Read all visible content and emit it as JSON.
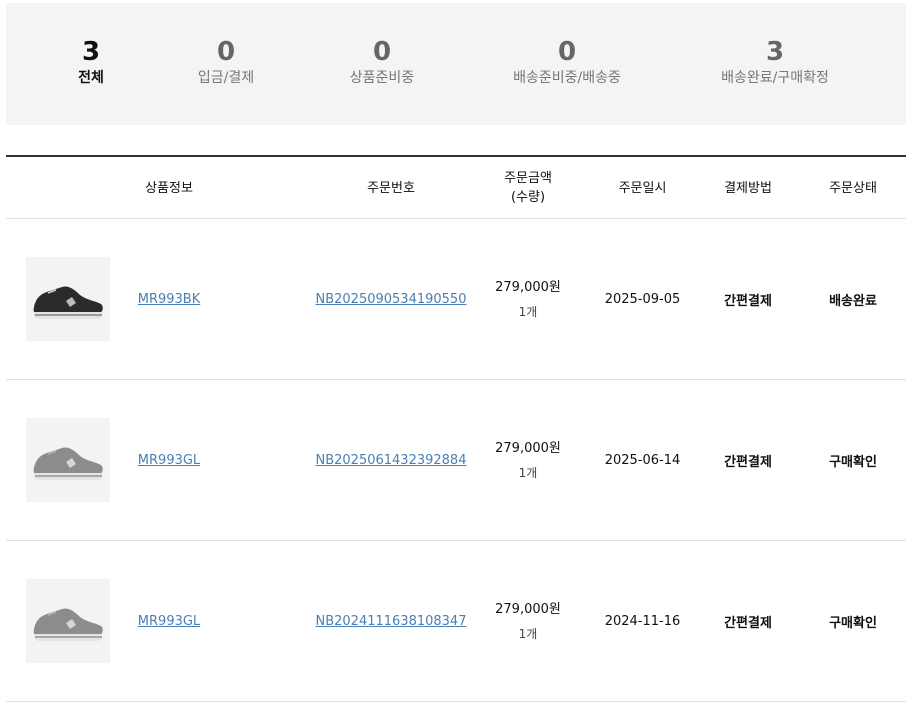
{
  "summary": [
    {
      "count": "3",
      "label": "전체",
      "active": true
    },
    {
      "count": "0",
      "label": "입금/결제",
      "active": false
    },
    {
      "count": "0",
      "label": "상품준비중",
      "active": false
    },
    {
      "count": "0",
      "label": "배송준비중/배송중",
      "active": false
    },
    {
      "count": "3",
      "label": "배송완료/구매확정",
      "active": false
    }
  ],
  "table": {
    "headers": {
      "product_info": "상품정보",
      "order_no": "주문번호",
      "amount_line1": "주문금액",
      "amount_line2": "(수량)",
      "order_date": "주문일시",
      "payment": "결제방법",
      "status": "주문상태"
    },
    "rows": [
      {
        "product": "MR993BK",
        "order_no": "NB2025090534190550",
        "amount": "279,000원",
        "qty": "1개",
        "date": "2025-09-05",
        "payment": "간편결제",
        "status": "배송완료",
        "shoe_color": "#2b2b2b"
      },
      {
        "product": "MR993GL",
        "order_no": "NB2025061432392884",
        "amount": "279,000원",
        "qty": "1개",
        "date": "2025-06-14",
        "payment": "간편결제",
        "status": "구매확인",
        "shoe_color": "#8c8c8c"
      },
      {
        "product": "MR993GL",
        "order_no": "NB2024111638108347",
        "amount": "279,000원",
        "qty": "1개",
        "date": "2024-11-16",
        "payment": "간편결제",
        "status": "구매확인",
        "shoe_color": "#8c8c8c"
      }
    ]
  }
}
